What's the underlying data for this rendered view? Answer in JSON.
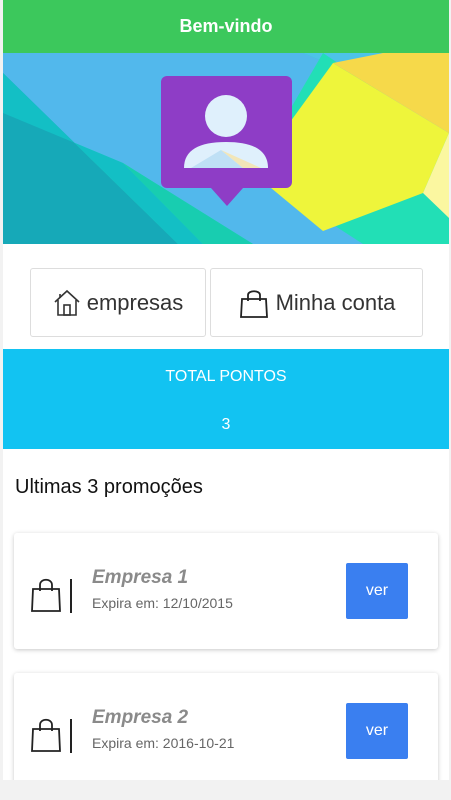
{
  "header": {
    "title": "Bem-vindo"
  },
  "profile": {
    "avatar_icon": "user-avatar-icon"
  },
  "nav": {
    "companies_label": "empresas",
    "companies_icon": "home-icon",
    "account_label": "Minha conta",
    "account_icon": "shopping-bag-icon"
  },
  "points": {
    "title": "TOTAL PONTOS",
    "value": "3"
  },
  "promotions": {
    "title": "Ultimas 3 promoções",
    "items": [
      {
        "company": "Empresa 1",
        "expires": "Expira em: 12/10/2015",
        "button": "ver",
        "icon": "shopping-bag-icon"
      },
      {
        "company": "Empresa 2",
        "expires": "Expira em: 2016-10-21",
        "button": "ver",
        "icon": "shopping-bag-icon"
      }
    ]
  },
  "colors": {
    "header_green": "#3cc85c",
    "points_blue": "#12c3f2",
    "avatar_purple": "#8e3dc6",
    "button_blue": "#3a7ff0"
  }
}
